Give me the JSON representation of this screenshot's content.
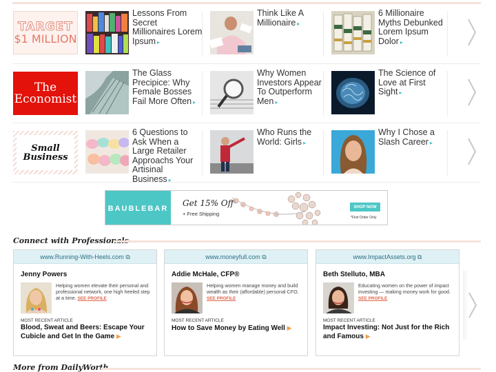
{
  "feed": {
    "rows": [
      {
        "logo": {
          "lines": [
            "TARGET",
            "$1 MILLION"
          ]
        },
        "items": [
          {
            "title": "Lessons From Secret Millionaires Lorem Ipsum"
          },
          {
            "title": "Think Like A Millionaire"
          },
          {
            "title": "6 Millionaire Myths Debunked Lorem Ipsum Dolor"
          }
        ]
      },
      {
        "logo": {
          "lines": [
            "The",
            "Economist"
          ]
        },
        "items": [
          {
            "title": "The Glass Precipice: Why Female Bosses Fail More Often"
          },
          {
            "title": "Why Women Investors Appear To Outperform Men"
          },
          {
            "title": "The Science of Love at First Sight"
          }
        ]
      },
      {
        "logo": {
          "lines": [
            "Small",
            "Business"
          ]
        },
        "items": [
          {
            "title": "6 Questions to Ask When a Large Retailer Approachs Your Artisinal Business"
          },
          {
            "title": "Who Runs the World: Girls"
          },
          {
            "title": "Why I Chose a Slash Career"
          }
        ]
      }
    ],
    "arrow_glyph": "▸",
    "next_icon": "chevron-right-icon"
  },
  "ad": {
    "brand": "BAUBLEBAR",
    "offer": "Get 15% Off*",
    "shipping": "+ Free Shipping",
    "cta": "SHOP NOW",
    "fine_print": "*First Order Only",
    "accent": "#4dc6c6"
  },
  "connect": {
    "heading": "Connect with Professionals",
    "see_profile": "SEE PROFILE",
    "recent_label": "MOST RECENT ARTICLE",
    "cards": [
      {
        "site": "www.Running-With-Heels.com",
        "name": "Jenny Powers",
        "bio": "Helping women elevate their personal and professional network, one high heeled step at a time.",
        "article": "Blood, Sweat and Beers: Escape Your Cubicle and Get In the Game"
      },
      {
        "site": "www.moneyfull.com",
        "name": "Addie McHale, CFP®",
        "bio": "Helping women manage money and build wealth as their (affordable) personal CFO.",
        "article": "How to Save Money by Eating Well"
      },
      {
        "site": "www.ImpactAssets.org",
        "name": "Beth Stelluto, MBA",
        "bio": "Educating women on the power of impact investing — making money work for good.",
        "article": "Impact Investing: Not Just for the Rich and Famous"
      }
    ]
  },
  "more": {
    "heading": "More from DailyWorth"
  },
  "colors": {
    "teal_arrow": "#3dc1c7",
    "divider_pink": "#f6e1dc",
    "see_profile": "#e0664a",
    "card_header": "#dff1f5",
    "economist_red": "#e3120b"
  }
}
